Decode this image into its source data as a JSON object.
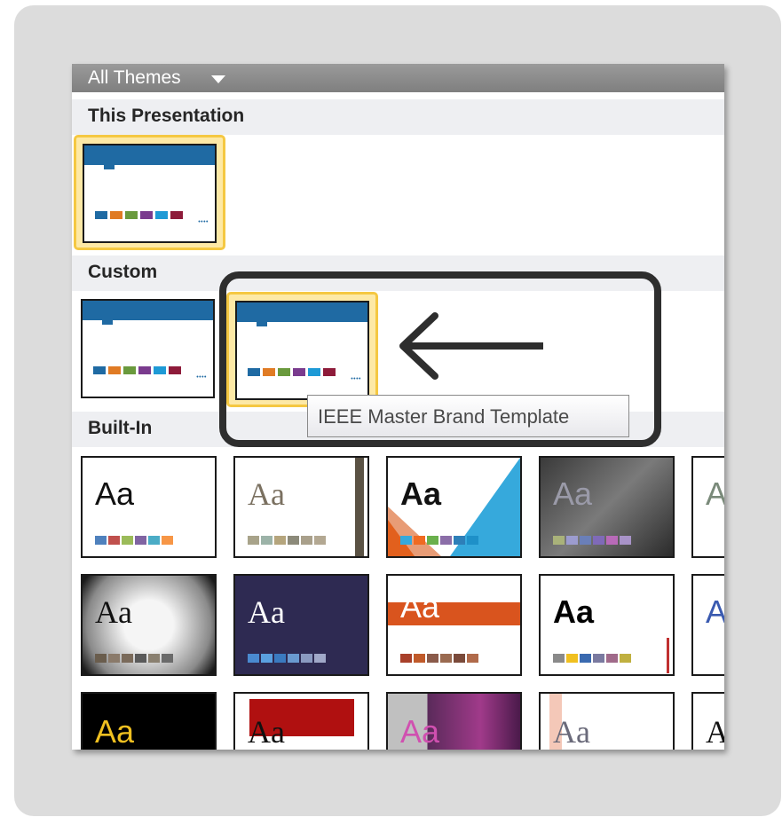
{
  "header": {
    "label": "All Themes"
  },
  "sections": {
    "this_presentation": "This Presentation",
    "custom": "Custom",
    "built_in": "Built-In"
  },
  "tooltip": {
    "text": "IEEE Master Brand Template"
  },
  "colors": {
    "ieee_blue": "#1f6aa3",
    "selection": "#f5c842",
    "header_bar": "#8c8c8c"
  },
  "ieee_swatches": [
    "#1f6aa3",
    "#e07b24",
    "#6a9a3d",
    "#7a3b8e",
    "#1e9ad6",
    "#8e1b3a"
  ],
  "builtin_themes": [
    {
      "sample": "Aa"
    },
    {
      "sample": "Aa"
    },
    {
      "sample": "Aa"
    },
    {
      "sample": "Aa"
    },
    {
      "sample": "A"
    },
    {
      "sample": "Aa"
    },
    {
      "sample": "Aa"
    },
    {
      "sample": "Aa"
    },
    {
      "sample": "Aa"
    },
    {
      "sample": "A"
    },
    {
      "sample": "Aa"
    },
    {
      "sample": "Aa"
    },
    {
      "sample": "Aa"
    },
    {
      "sample": "Aa"
    },
    {
      "sample": "A"
    }
  ]
}
